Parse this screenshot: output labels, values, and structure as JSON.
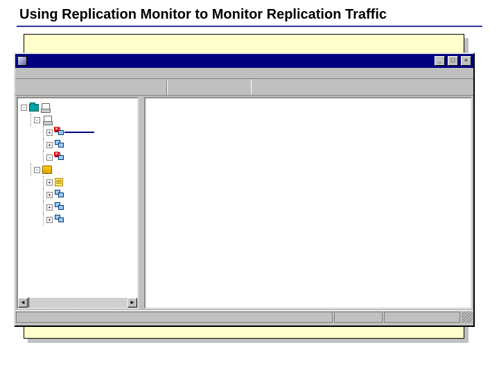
{
  "slide": {
    "title": "Using Replication Monitor to Monitor Replication Traffic"
  },
  "window": {
    "title": "",
    "buttons": {
      "min": "_",
      "max": "□",
      "close": "×"
    }
  },
  "tree": {
    "root_expander": "-",
    "group1": {
      "expander": "-",
      "nodes": [
        {
          "expander": "+",
          "icon": "monitor-pair-error",
          "label": "",
          "selected": true
        },
        {
          "expander": "+",
          "icon": "monitor-pair",
          "label": "",
          "selected": false
        },
        {
          "expander": "-",
          "icon": "monitor-pair-error",
          "label": "",
          "selected": false
        }
      ]
    },
    "group2": {
      "expander": "-",
      "icon": "publication",
      "nodes": [
        {
          "expander": "+",
          "icon": "monitor-pair",
          "label": ""
        },
        {
          "expander": "+",
          "icon": "monitor-pair",
          "label": ""
        },
        {
          "expander": "+",
          "icon": "monitor-pair",
          "label": ""
        }
      ]
    },
    "extra_book_node": {
      "expander": "+",
      "icon": "book",
      "label": ""
    }
  },
  "scrollbar": {
    "left": "◄",
    "right": "►"
  },
  "status": {
    "main": "",
    "cell1": "",
    "cell2": ""
  }
}
